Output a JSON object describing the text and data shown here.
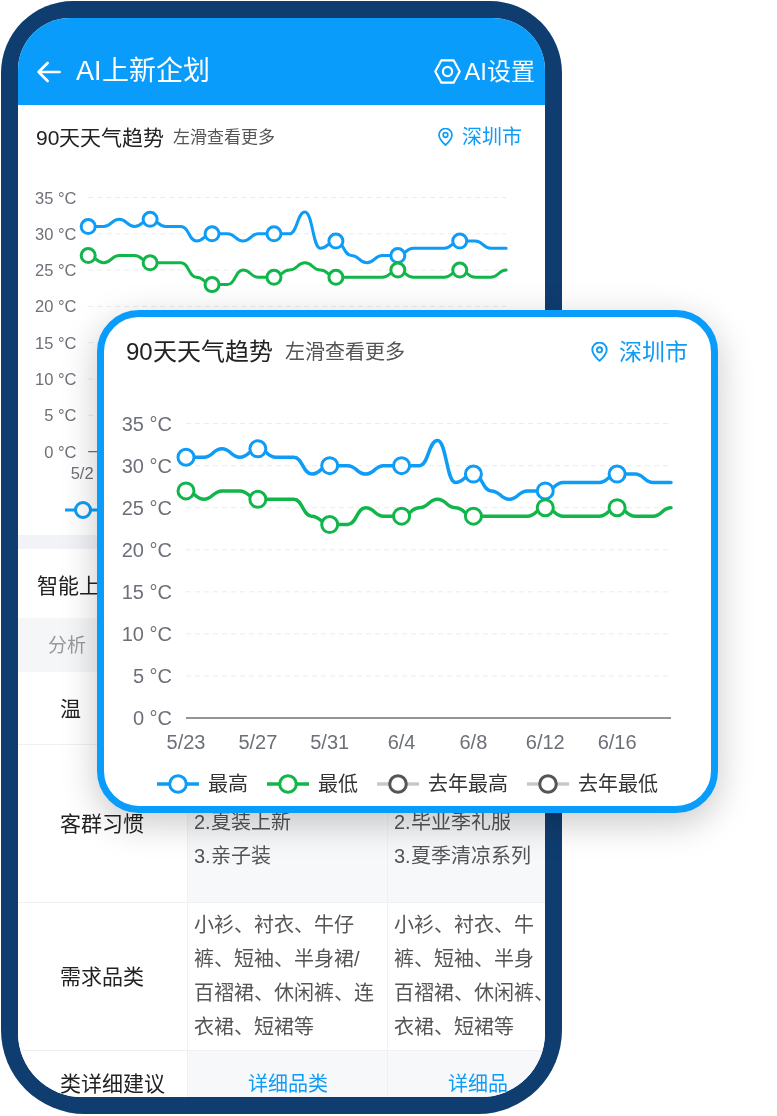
{
  "header": {
    "title": "AI上新企划",
    "action": "AI设置"
  },
  "weather_card": {
    "title": "90天天气趋势",
    "hint": "左滑查看更多",
    "city": "深圳市",
    "chart_data": {
      "type": "line",
      "grid": true,
      "categories": [
        "5/2",
        null,
        null,
        null,
        null,
        null,
        null,
        null,
        null,
        null,
        null,
        null,
        null,
        null,
        null,
        null,
        null,
        null,
        null,
        null,
        null,
        null,
        null,
        null,
        null,
        null,
        null,
        null
      ],
      "ylim": [
        0,
        35
      ],
      "yticks": [
        {
          "value": 0,
          "label": "0 °C"
        },
        {
          "value": 5,
          "label": "5 °C"
        },
        {
          "value": 10,
          "label": "10 °C"
        },
        {
          "value": 15,
          "label": "15 °C"
        },
        {
          "value": 20,
          "label": "20 °C"
        },
        {
          "value": 25,
          "label": "25 °C"
        },
        {
          "value": 30,
          "label": "30 °C"
        },
        {
          "value": 35,
          "label": "35 °C"
        }
      ],
      "series": [
        {
          "color": "#0e9cf6",
          "values": [
            31,
            31,
            32,
            31,
            32,
            31,
            31,
            29,
            30,
            30,
            29,
            30,
            30,
            30,
            33,
            28,
            29,
            27,
            26,
            27,
            27,
            28,
            28,
            28,
            29,
            29,
            28,
            28
          ]
        },
        {
          "color": "#10b64a",
          "values": [
            27,
            26,
            27,
            27,
            26,
            26,
            26,
            24,
            23,
            23,
            25,
            24,
            24,
            25,
            26,
            25,
            24,
            24,
            24,
            24,
            25,
            24,
            24,
            24,
            25,
            24,
            24,
            25
          ]
        }
      ]
    }
  },
  "section": {
    "title": "智能上",
    "table": {
      "columns": [
        "分析"
      ],
      "rows": [
        {
          "label": "温"
        },
        {
          "label": "客群习惯",
          "cells": [
            {
              "kind": "list",
              "items": [
                "2.夏装上新",
                "3.亲子装"
              ]
            },
            {
              "kind": "list",
              "items": [
                "2.毕业季礼服",
                "3.夏季清凉系列"
              ]
            }
          ]
        },
        {
          "label": "需求品类",
          "cells": [
            {
              "kind": "text",
              "text": "小衫、衬衣、牛仔裤、短袖、半身裙/百褶裙、休闲裤、连衣裙、短裙等"
            },
            {
              "kind": "lines",
              "lines": [
                "小衫、衬衣、牛",
                "裤、短袖、半身",
                "百褶裙、休闲裤、",
                "衣裙、短裙等"
              ]
            }
          ]
        },
        {
          "label": "类详细建议",
          "cells": [
            {
              "kind": "link",
              "text": "详细品类"
            },
            {
              "kind": "link",
              "text": "详细品"
            }
          ]
        }
      ]
    }
  },
  "overlay_card": {
    "title": "90天天气趋势",
    "hint": "左滑查看更多",
    "city": "深圳市",
    "chart_data": {
      "type": "line",
      "grid": true,
      "categories": [
        "5/23",
        null,
        null,
        null,
        "5/27",
        null,
        null,
        null,
        "5/31",
        null,
        null,
        null,
        "6/4",
        null,
        null,
        null,
        "6/8",
        null,
        null,
        null,
        "6/12",
        null,
        null,
        null,
        "6/16",
        null,
        null,
        null
      ],
      "ylim": [
        0,
        35
      ],
      "yticks": [
        {
          "value": 0,
          "label": "0 °C"
        },
        {
          "value": 5,
          "label": "5 °C"
        },
        {
          "value": 10,
          "label": "10 °C"
        },
        {
          "value": 15,
          "label": "15 °C"
        },
        {
          "value": 20,
          "label": "20 °C"
        },
        {
          "value": 25,
          "label": "25 °C"
        },
        {
          "value": 30,
          "label": "30 °C"
        },
        {
          "value": 35,
          "label": "35 °C"
        }
      ],
      "series": [
        {
          "name": "最高",
          "color": "#0e9cf6",
          "values": [
            31,
            31,
            32,
            31,
            32,
            31,
            31,
            29,
            30,
            30,
            29,
            30,
            30,
            30,
            33,
            28,
            29,
            27,
            26,
            27,
            27,
            28,
            28,
            28,
            29,
            29,
            28,
            28
          ]
        },
        {
          "name": "最低",
          "color": "#10b64a",
          "values": [
            27,
            26,
            27,
            27,
            26,
            26,
            26,
            24,
            23,
            23,
            25,
            24,
            24,
            25,
            26,
            25,
            24,
            24,
            24,
            24,
            25,
            24,
            24,
            24,
            25,
            24,
            24,
            25
          ]
        },
        {
          "name": "去年最高",
          "color": "#555555",
          "values": [
            null,
            null,
            null,
            null,
            null,
            null,
            null,
            null,
            null,
            null,
            null,
            null,
            null,
            null,
            null,
            null,
            null,
            null,
            null,
            null,
            null,
            null,
            null,
            null,
            null,
            null,
            null,
            null
          ]
        },
        {
          "name": "去年最低",
          "color": "#555555",
          "values": [
            null,
            null,
            null,
            null,
            null,
            null,
            null,
            null,
            null,
            null,
            null,
            null,
            null,
            null,
            null,
            null,
            null,
            null,
            null,
            null,
            null,
            null,
            null,
            null,
            null,
            null,
            null,
            null
          ]
        }
      ]
    }
  }
}
